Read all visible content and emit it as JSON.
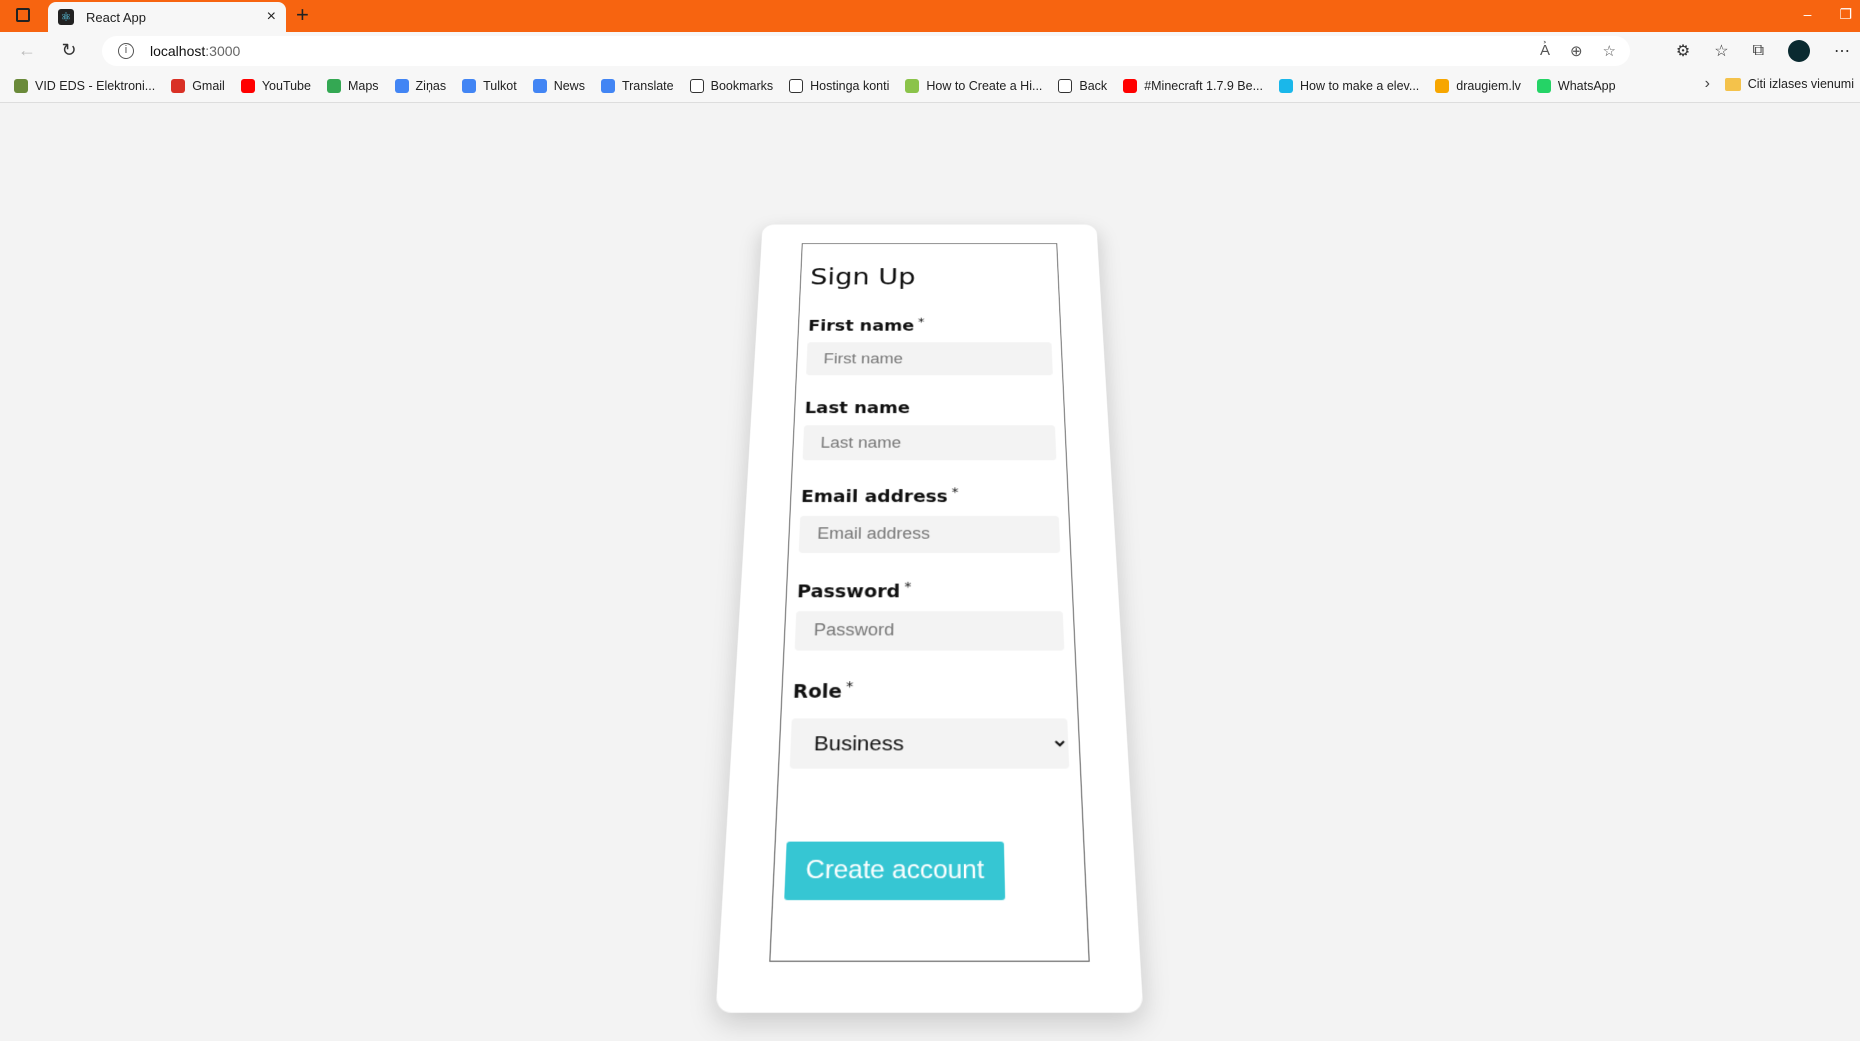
{
  "browser": {
    "tab_title": "React App",
    "url_host": "localhost",
    "url_port": ":3000",
    "bookmarks": [
      {
        "label": "VID EDS - Elektroni...",
        "color": "#6a8a3a"
      },
      {
        "label": "Gmail",
        "color": "#d93025"
      },
      {
        "label": "YouTube",
        "color": "#ff0000"
      },
      {
        "label": "Maps",
        "color": "#34a853"
      },
      {
        "label": "Ziņas",
        "color": "#4285f4"
      },
      {
        "label": "Tulkot",
        "color": "#4285f4"
      },
      {
        "label": "News",
        "color": "#4285f4"
      },
      {
        "label": "Translate",
        "color": "#4285f4"
      },
      {
        "label": "Bookmarks",
        "color": "#ffffff"
      },
      {
        "label": "Hostinga konti",
        "color": "#ffffff"
      },
      {
        "label": "How to Create a Hi...",
        "color": "#8bc34a"
      },
      {
        "label": "Back",
        "color": "#ffffff"
      },
      {
        "label": "#Minecraft 1.7.9 Be...",
        "color": "#ff0000"
      },
      {
        "label": "How to make a elev...",
        "color": "#1ab7ea"
      },
      {
        "label": "draugiem.lv",
        "color": "#f7a600"
      },
      {
        "label": "WhatsApp",
        "color": "#25d366"
      }
    ],
    "other_bookmarks": "Citi izlases vienumi"
  },
  "form": {
    "title": "Sign Up",
    "required_mark": "*",
    "first_name": {
      "label": "First name",
      "placeholder": "First name"
    },
    "last_name": {
      "label": "Last name",
      "placeholder": "Last name"
    },
    "email": {
      "label": "Email address",
      "placeholder": "Email address"
    },
    "password": {
      "label": "Password",
      "placeholder": "Password"
    },
    "role": {
      "label": "Role",
      "selected": "Business"
    },
    "submit": "Create account"
  }
}
